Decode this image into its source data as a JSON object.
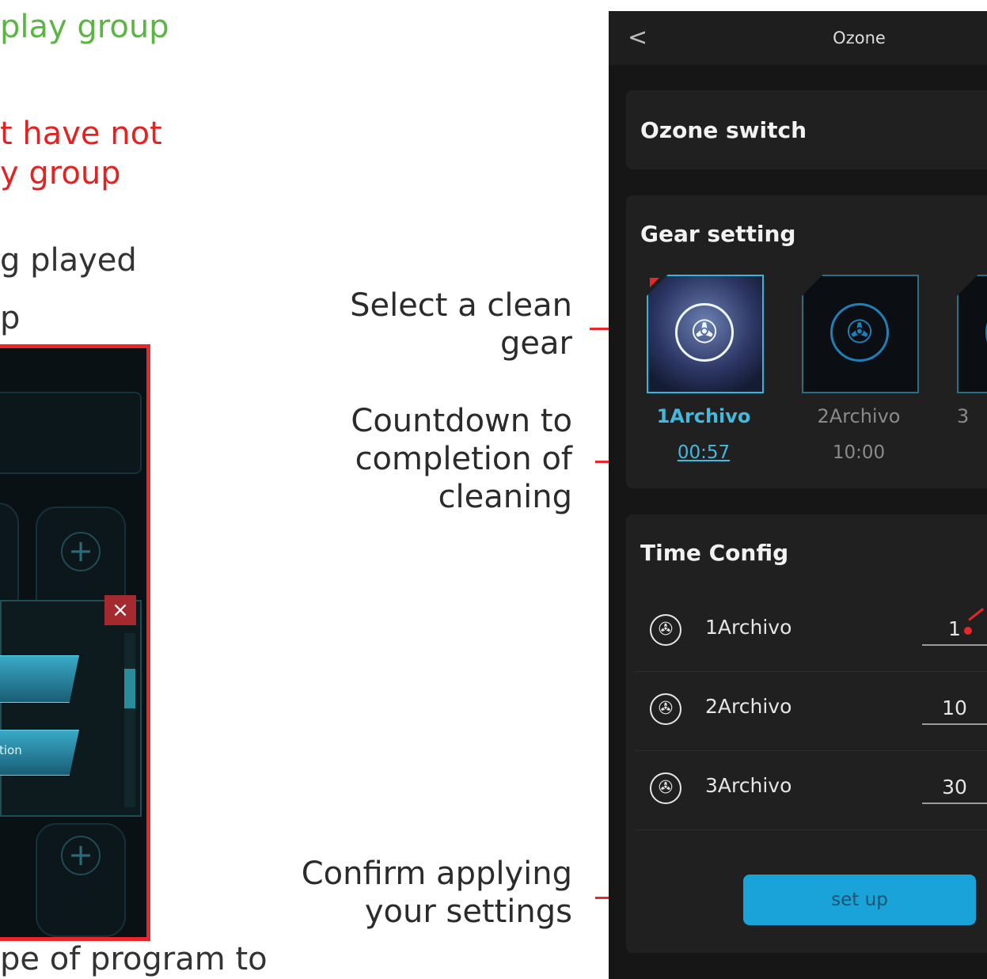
{
  "left_text": {
    "line1": "play group",
    "line2": "t have not",
    "line3": "y group",
    "line4": "g played",
    "line5": "p",
    "line6": "pe of program to"
  },
  "left_shot": {
    "option_text": "tion"
  },
  "annotations": {
    "select_gear": [
      "Select a clean",
      "gear"
    ],
    "countdown": [
      "Countdown to",
      "completion of",
      "cleaning"
    ],
    "confirm": [
      "Confirm applying",
      "your settings"
    ],
    "accent": "#e8262b"
  },
  "app": {
    "title": "Ozone",
    "ozone_switch": "Ozone switch",
    "gear_setting": {
      "title": "Gear setting",
      "gears": [
        {
          "name": "1Archivo",
          "time": "00:57",
          "icon": "fan-1-icon",
          "active": true
        },
        {
          "name": "2Archivo",
          "time": "10:00",
          "icon": "fan-2-icon",
          "active": false
        },
        {
          "name": "3",
          "time": "",
          "icon": "fan-3-icon",
          "active": false
        }
      ]
    },
    "time_config": {
      "title": "Time Config",
      "rows": [
        {
          "label": "1Archivo",
          "value": "1"
        },
        {
          "label": "2Archivo",
          "value": "10"
        },
        {
          "label": "3Archivo",
          "value": "30"
        }
      ]
    },
    "setup_button": "set up",
    "colors": {
      "accent": "#1aa3d9",
      "active_text": "#45b8dd",
      "background": "#161616"
    }
  }
}
